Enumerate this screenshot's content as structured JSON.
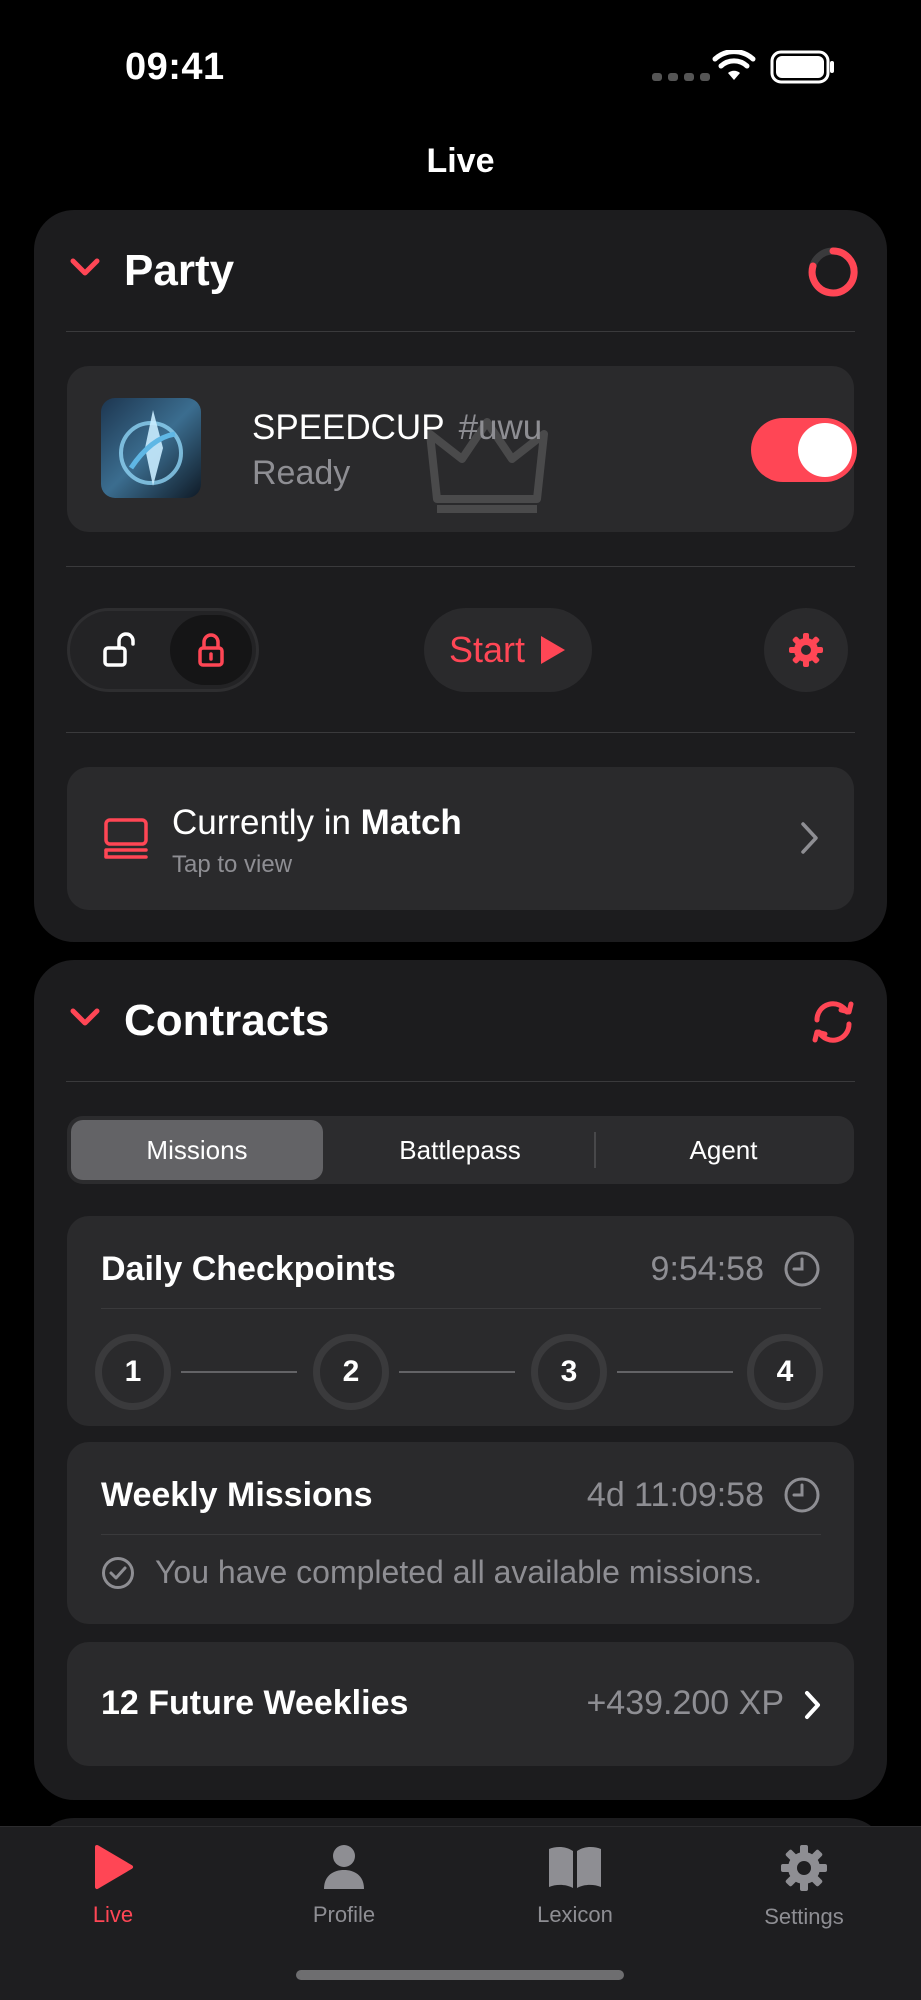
{
  "status_bar": {
    "time": "09:41"
  },
  "nav": {
    "title": "Live"
  },
  "party": {
    "title": "Party",
    "member": {
      "name": "SPEEDCUP",
      "tag": "#uwu",
      "status": "Ready",
      "ready_toggle_on": true
    },
    "start_label": "Start",
    "match": {
      "prefix": "Currently in ",
      "state": "Match",
      "subtitle": "Tap to view"
    }
  },
  "contracts": {
    "title": "Contracts",
    "tabs": [
      "Missions",
      "Battlepass",
      "Agent"
    ],
    "selected_tab": "Missions",
    "daily": {
      "title": "Daily Checkpoints",
      "time_left": "9:54:58",
      "checkpoints": [
        "1",
        "2",
        "3",
        "4"
      ]
    },
    "weekly": {
      "title": "Weekly Missions",
      "time_left": "4d 11:09:58",
      "message": "You have completed all available missions."
    },
    "future": {
      "title": "12 Future Weeklies",
      "xp": "+439.200 XP"
    }
  },
  "tab_bar": {
    "items": [
      {
        "label": "Live",
        "icon": "play-icon",
        "active": true
      },
      {
        "label": "Profile",
        "icon": "person-icon",
        "active": false
      },
      {
        "label": "Lexicon",
        "icon": "book-icon",
        "active": false
      },
      {
        "label": "Settings",
        "icon": "gear-icon",
        "active": false
      }
    ]
  },
  "colors": {
    "accent": "#ff4655",
    "card": "#1c1c1e",
    "inner": "#2a2a2c",
    "secondary_text": "#8e8e93"
  }
}
